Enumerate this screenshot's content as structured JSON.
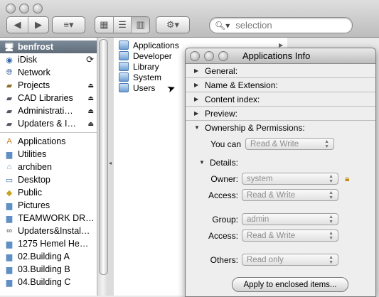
{
  "toolbar": {
    "back_icon": "back-arrow-icon",
    "forward_icon": "forward-arrow-icon",
    "search_placeholder": "selection"
  },
  "sidebar": {
    "devices": [
      {
        "label": "benfrost",
        "icon": "computer-icon",
        "selected": true
      },
      {
        "label": "iDisk",
        "icon": "idisk-icon"
      },
      {
        "label": "Network",
        "icon": "network-icon"
      },
      {
        "label": "Projects",
        "icon": "server-icon",
        "eject": true
      },
      {
        "label": "CAD Libraries",
        "icon": "server-icon",
        "eject": true
      },
      {
        "label": "Administrati…",
        "icon": "server-icon",
        "eject": true
      },
      {
        "label": "Updaters & I…",
        "icon": "server-icon",
        "eject": true
      }
    ],
    "places": [
      {
        "label": "Applications",
        "icon": "applications-icon"
      },
      {
        "label": "Utilities",
        "icon": "folder-icon"
      },
      {
        "label": "archiben",
        "icon": "home-icon"
      },
      {
        "label": "Desktop",
        "icon": "desktop-icon"
      },
      {
        "label": "Public",
        "icon": "public-icon"
      },
      {
        "label": "Pictures",
        "icon": "folder-icon"
      },
      {
        "label": "TEAMWORK DR…",
        "icon": "folder-icon"
      },
      {
        "label": "Updaters&Instal…",
        "icon": "binoculars-icon"
      },
      {
        "label": "1275 Hemel He…",
        "icon": "folder-icon"
      },
      {
        "label": "02.Building A",
        "icon": "folder-icon"
      },
      {
        "label": "03.Building B",
        "icon": "folder-icon"
      },
      {
        "label": "04.Building C",
        "icon": "folder-icon"
      }
    ]
  },
  "column": {
    "items": [
      "Applications",
      "Developer",
      "Library",
      "System",
      "Users"
    ]
  },
  "info": {
    "title": "Applications Info",
    "sections": {
      "general": "General:",
      "name_extension": "Name & Extension:",
      "content_index": "Content index:",
      "preview": "Preview:",
      "ownership": "Ownership & Permissions:"
    },
    "you_can_label": "You can",
    "you_can_value": "Read & Write",
    "details_label": "Details:",
    "owner_label": "Owner:",
    "owner_value": "system",
    "owner_access_label": "Access:",
    "owner_access_value": "Read & Write",
    "group_label": "Group:",
    "group_value": "admin",
    "group_access_label": "Access:",
    "group_access_value": "Read & Write",
    "others_label": "Others:",
    "others_value": "Read only",
    "apply_button": "Apply to enclosed items..."
  }
}
